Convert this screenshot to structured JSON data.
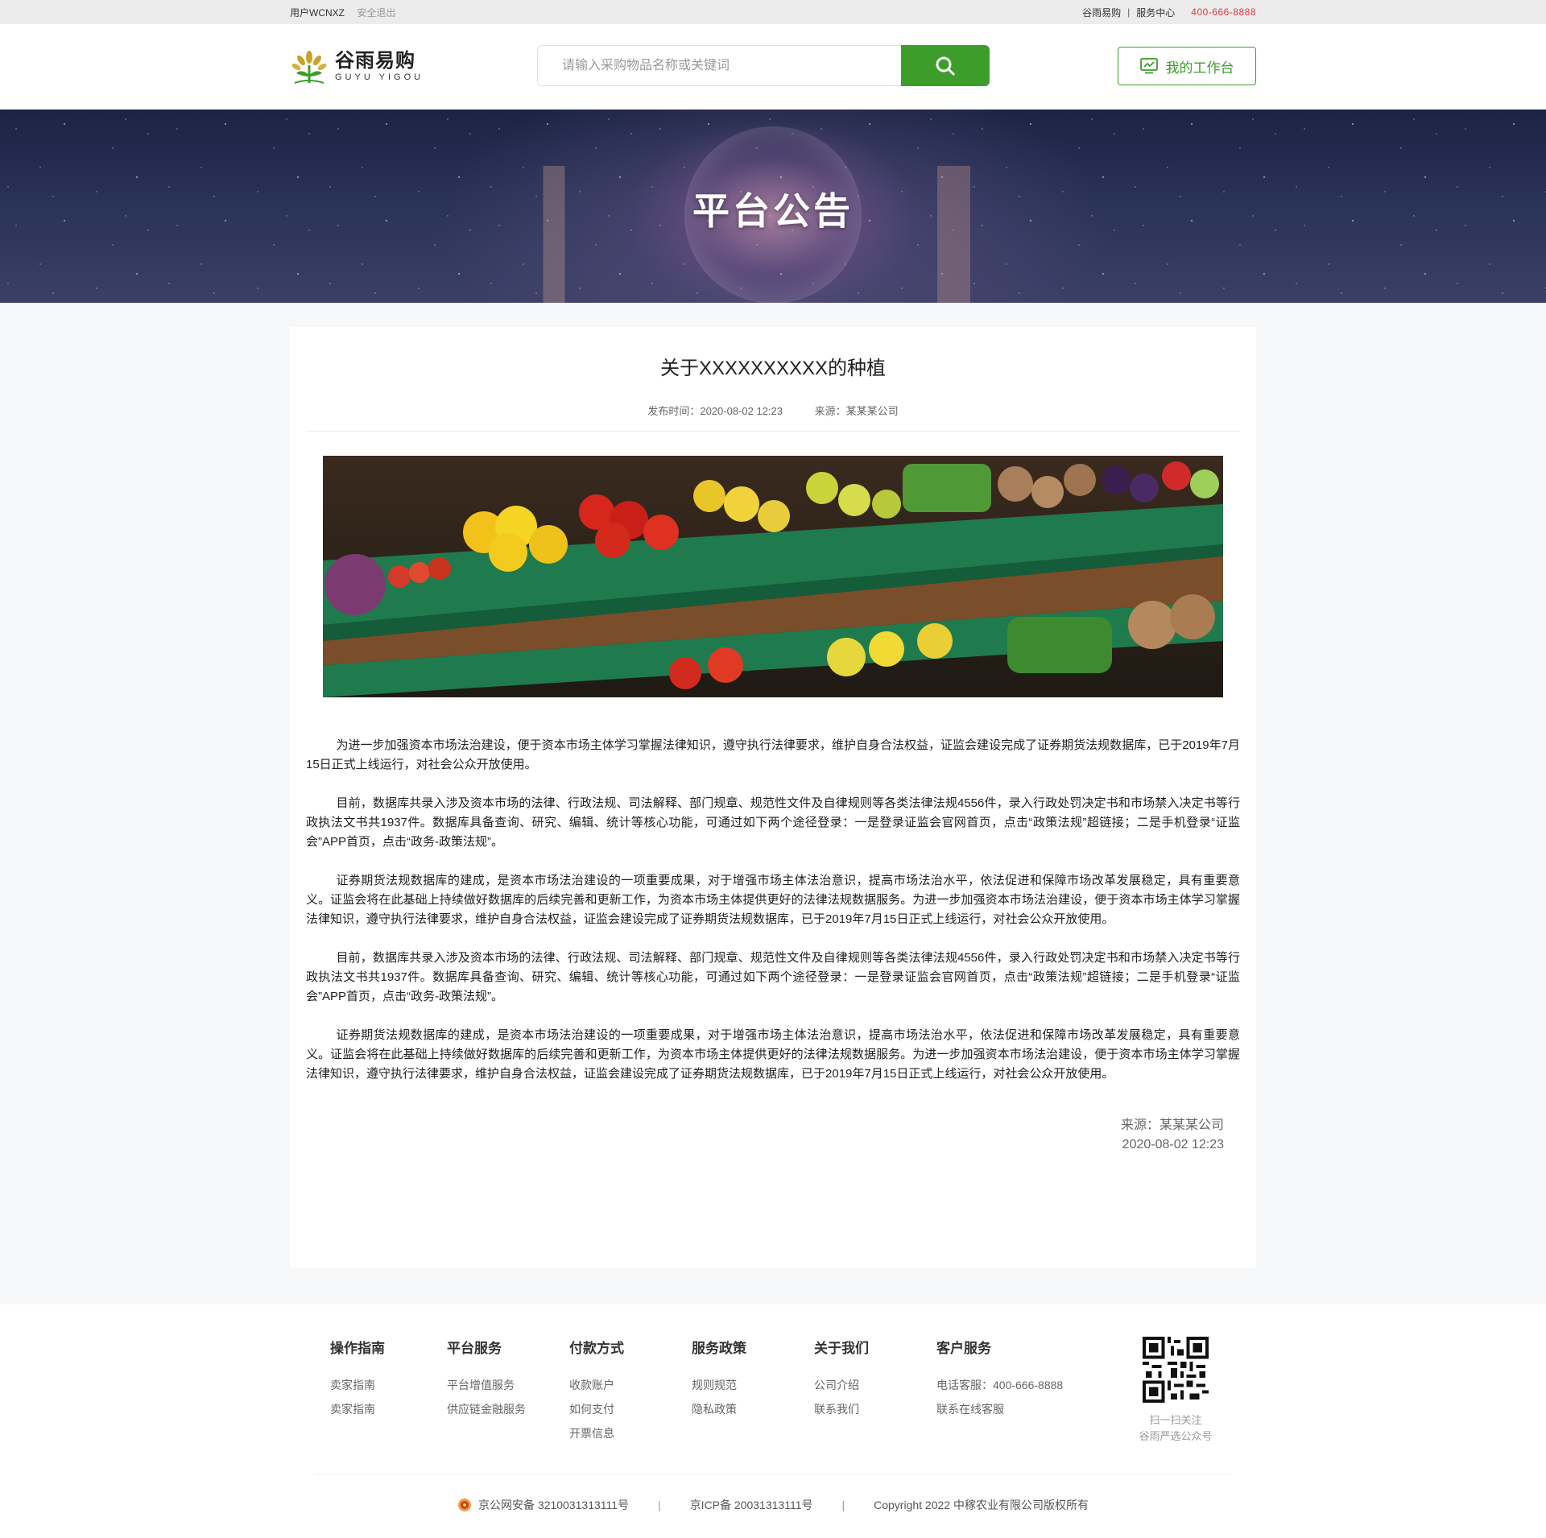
{
  "topbar": {
    "user": "用户WCNXZ",
    "logout": "安全退出",
    "links": [
      "谷雨易购",
      "服务中心"
    ],
    "phone": "400-666-8888"
  },
  "header": {
    "logo_cn": "谷雨易购",
    "logo_en": "GUYU YIGOU",
    "search_placeholder": "请输入采购物品名称或关键词",
    "workbench_label": "我的工作台"
  },
  "banner": {
    "title": "平台公告"
  },
  "article": {
    "title": "关于XXXXXXXXXX的种植",
    "publish_time": "发布时间：2020-08-02 12:23",
    "source": "来源：某某某公司",
    "paragraphs": [
      "为进一步加强资本市场法治建设，便于资本市场主体学习掌握法律知识，遵守执行法律要求，维护自身合法权益，证监会建设完成了证券期货法规数据库，已于2019年7月15日正式上线运行，对社会公众开放使用。",
      "目前，数据库共录入涉及资本市场的法律、行政法规、司法解释、部门规章、规范性文件及自律规则等各类法律法规4556件，录入行政处罚决定书和市场禁入决定书等行政执法文书共1937件。数据库具备查询、研究、编辑、统计等核心功能，可通过如下两个途径登录：一是登录证监会官网首页，点击“政策法规”超链接；二是手机登录“证监会”APP首页，点击“政务-政策法规”。",
      "证券期货法规数据库的建成，是资本市场法治建设的一项重要成果，对于增强市场主体法治意识，提高市场法治水平，依法促进和保障市场改革发展稳定，具有重要意义。证监会将在此基础上持续做好数据库的后续完善和更新工作，为资本市场主体提供更好的法律法规数据服务。为进一步加强资本市场法治建设，便于资本市场主体学习掌握法律知识，遵守执行法律要求，维护自身合法权益，证监会建设完成了证券期货法规数据库，已于2019年7月15日正式上线运行，对社会公众开放使用。",
      "目前，数据库共录入涉及资本市场的法律、行政法规、司法解释、部门规章、规范性文件及自律规则等各类法律法规4556件，录入行政处罚决定书和市场禁入决定书等行政执法文书共1937件。数据库具备查询、研究、编辑、统计等核心功能，可通过如下两个途径登录：一是登录证监会官网首页，点击“政策法规”超链接；二是手机登录“证监会”APP首页，点击“政务-政策法规”。",
      "证券期货法规数据库的建成，是资本市场法治建设的一项重要成果，对于增强市场主体法治意识，提高市场法治水平，依法促进和保障市场改革发展稳定，具有重要意义。证监会将在此基础上持续做好数据库的后续完善和更新工作，为资本市场主体提供更好的法律法规数据服务。为进一步加强资本市场法治建设，便于资本市场主体学习掌握法律知识，遵守执行法律要求，维护自身合法权益，证监会建设完成了证券期货法规数据库，已于2019年7月15日正式上线运行，对社会公众开放使用。"
    ],
    "sign_source": "来源：某某某公司",
    "sign_time": "2020-08-02 12:23"
  },
  "footer": {
    "columns": [
      {
        "title": "操作指南",
        "links": [
          "卖家指南",
          "卖家指南"
        ]
      },
      {
        "title": "平台服务",
        "links": [
          "平台增值服务",
          "供应链金融服务"
        ]
      },
      {
        "title": "付款方式",
        "links": [
          "收款账户",
          "如何支付",
          "开票信息"
        ]
      },
      {
        "title": "服务政策",
        "links": [
          "规则规范",
          "隐私政策"
        ]
      },
      {
        "title": "关于我们",
        "links": [
          "公司介绍",
          "联系我们"
        ]
      },
      {
        "title": "客户服务",
        "links": [
          "电话客服：400-666-8888",
          "联系在线客服"
        ]
      }
    ],
    "qr_line1": "扫一扫关注",
    "qr_line2": "谷雨严选公众号",
    "police": "京公网安备 3210031313111号",
    "icp": "京ICP备 20031313111号",
    "copyright": "Copyright 2022 中稼农业有限公司版权所有",
    "separator": "|"
  },
  "colors": {
    "brand_green": "#3d9d2a",
    "phone_red": "#e2383f"
  }
}
